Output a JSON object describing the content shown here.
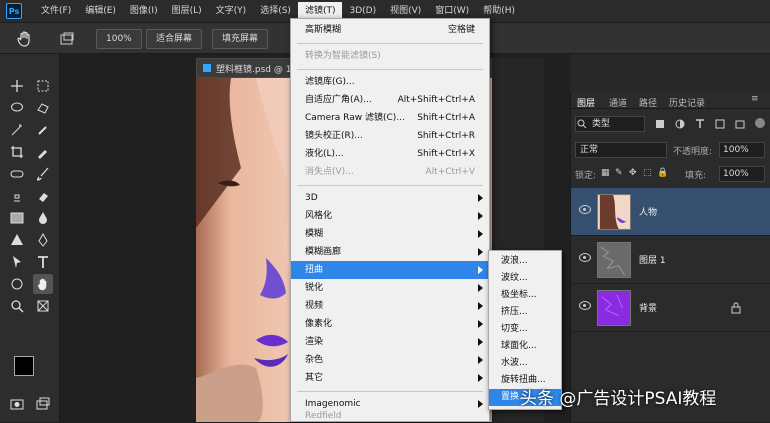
{
  "menubar": {
    "items": [
      "文件(F)",
      "编辑(E)",
      "图像(I)",
      "图层(L)",
      "文字(Y)",
      "选择(S)",
      "滤镜(T)",
      "3D(D)",
      "视图(V)",
      "窗口(W)",
      "帮助(H)"
    ],
    "logo": "Ps"
  },
  "options": {
    "zoom_label": "100%",
    "fit_screen": "适合屏幕",
    "fill_screen": "填充屏幕"
  },
  "document": {
    "tab_title": "塑料框镜.psd @ 100%"
  },
  "filter_menu": {
    "items": [
      {
        "label": "高斯模糊",
        "shortcut": "空格键",
        "disabled": false
      },
      {
        "label": "转换为智能滤镜(S)",
        "shortcut": "",
        "disabled": true
      },
      {
        "label": "滤镜库(G)...",
        "shortcut": "",
        "disabled": false
      },
      {
        "label": "自适应广角(A)...",
        "shortcut": "Alt+Shift+Ctrl+A",
        "disabled": false
      },
      {
        "label": "Camera Raw 滤镜(C)...",
        "shortcut": "Shift+Ctrl+A",
        "disabled": false
      },
      {
        "label": "镜头校正(R)...",
        "shortcut": "Shift+Ctrl+R",
        "disabled": false
      },
      {
        "label": "液化(L)...",
        "shortcut": "Shift+Ctrl+X",
        "disabled": false
      },
      {
        "label": "消失点(V)...",
        "shortcut": "Alt+Ctrl+V",
        "disabled": true
      },
      {
        "label": "3D",
        "shortcut": "",
        "disabled": false
      },
      {
        "label": "风格化",
        "shortcut": "",
        "disabled": false
      },
      {
        "label": "模糊",
        "shortcut": "",
        "disabled": false
      },
      {
        "label": "模糊画廊",
        "shortcut": "",
        "disabled": false
      },
      {
        "label": "扭曲",
        "shortcut": "",
        "disabled": false
      },
      {
        "label": "锐化",
        "shortcut": "",
        "disabled": false
      },
      {
        "label": "视频",
        "shortcut": "",
        "disabled": false
      },
      {
        "label": "像素化",
        "shortcut": "",
        "disabled": false
      },
      {
        "label": "渲染",
        "shortcut": "",
        "disabled": false
      },
      {
        "label": "杂色",
        "shortcut": "",
        "disabled": false
      },
      {
        "label": "其它",
        "shortcut": "",
        "disabled": false
      },
      {
        "label": "Imagenomic",
        "shortcut": "",
        "disabled": false
      },
      {
        "label": "Redfield",
        "shortcut": "",
        "disabled": true
      }
    ],
    "highlighted": "扭曲"
  },
  "distort_submenu": {
    "items": [
      "波浪...",
      "波纹...",
      "极坐标...",
      "挤压...",
      "切变...",
      "球面化...",
      "水波...",
      "旋转扭曲...",
      "置换..."
    ],
    "highlighted": "置换..."
  },
  "layers_panel": {
    "tabs": [
      "图层",
      "通道",
      "路径",
      "历史记录"
    ],
    "filter_kind": "类型",
    "blend_mode": "正常",
    "opacity_label": "不透明度:",
    "opacity_value": "100%",
    "lock_label": "锁定:",
    "fill_label": "填充:",
    "fill_value": "100%",
    "layers": [
      {
        "name": "人物",
        "selected": true
      },
      {
        "name": "图层 1",
        "selected": false
      },
      {
        "name": "背景",
        "selected": false
      }
    ]
  },
  "watermark": "头条 @广告设计PSAI教程",
  "colors": {
    "highlight": "#2f86e8",
    "menu_bg": "#f0f0f0",
    "panel_bg": "#2b2b2b",
    "purple": "#8a2be2"
  }
}
